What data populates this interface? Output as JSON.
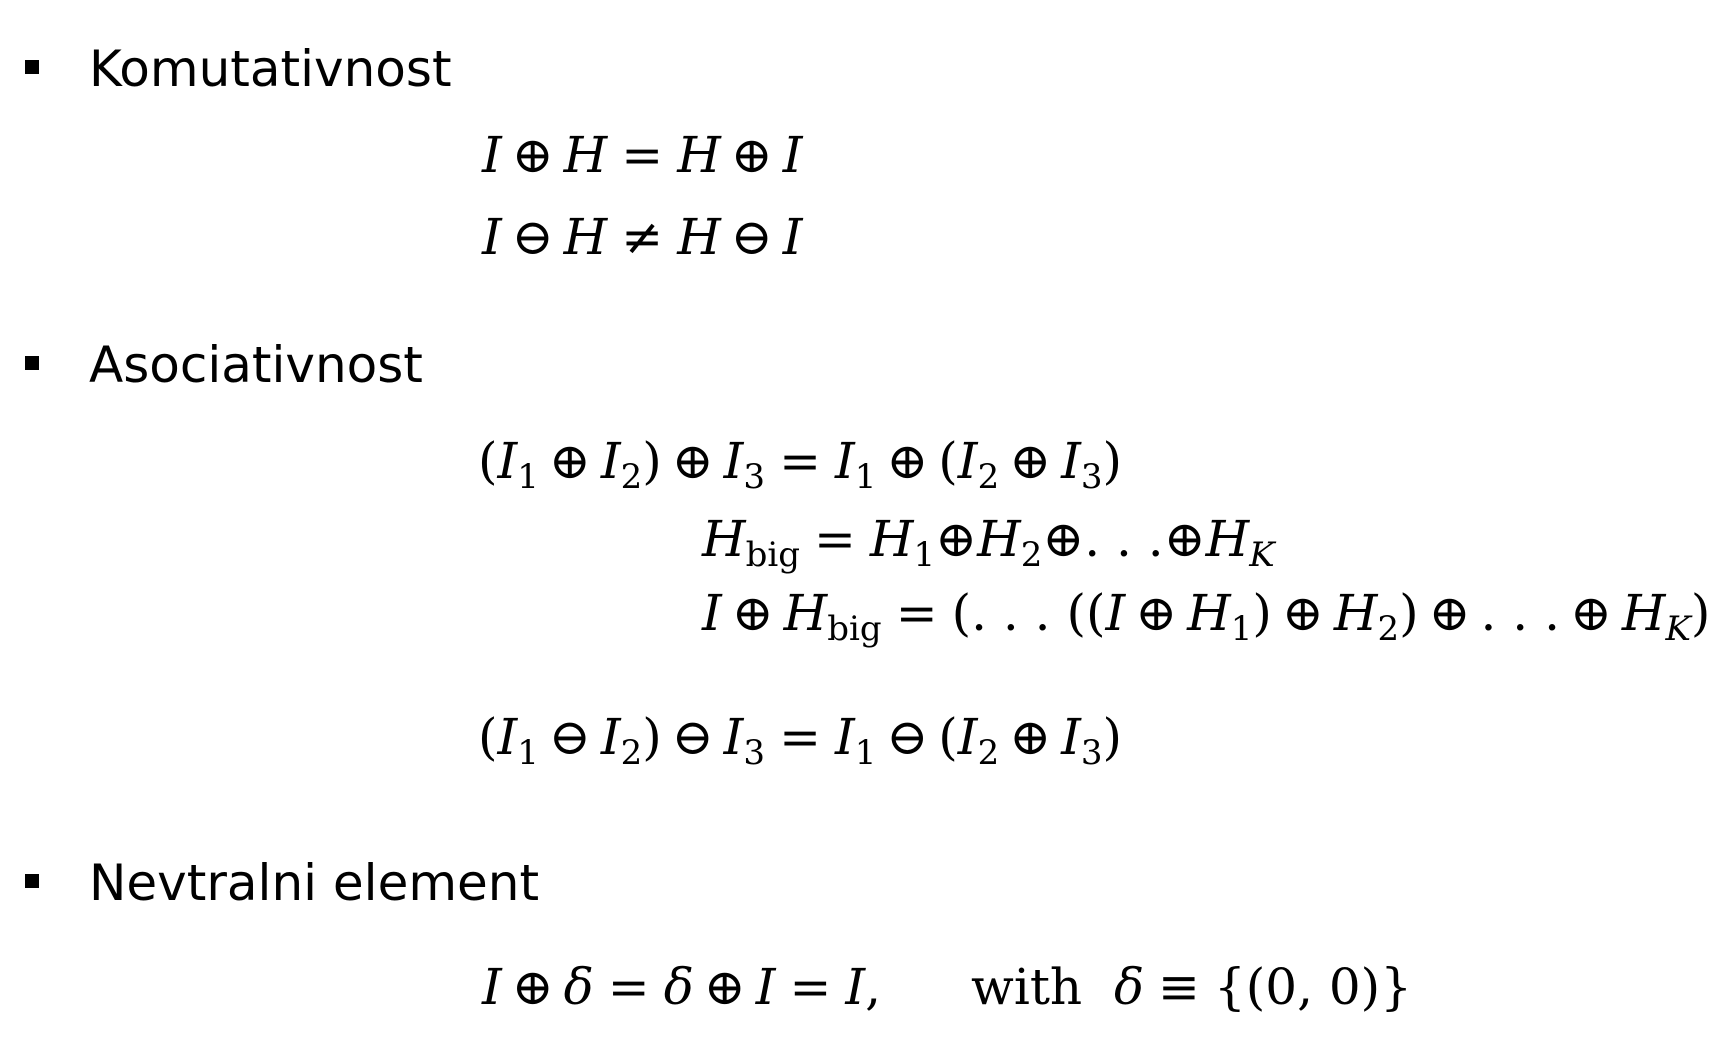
{
  "sections": [
    {
      "heading": "Komutativnost",
      "equations": [
        "I ⊕ H = H ⊕ I",
        "I ⊖ H ≠ H ⊖ I"
      ]
    },
    {
      "heading": "Asociativnost",
      "equations": [
        "(I1 ⊕ I2) ⊕ I3 = I1 ⊕ (I2 ⊕ I3)",
        "Hbig = H1 ⊕ H2 ⊕ ... ⊕ HK",
        "I ⊕ Hbig = (...((I ⊕ H1) ⊕ H2) ⊕ ... ⊕ HK)",
        "(I1 ⊖ I2) ⊖ I3 = I1 ⊖ (I2 ⊕ I3)"
      ]
    },
    {
      "heading": "Nevtralni element",
      "equations": [
        "I ⊕ δ = δ ⊕ I = I, with δ ≡ {(0,0)}"
      ]
    }
  ],
  "labels": {
    "big_subscript": "big",
    "with_word": "with"
  }
}
